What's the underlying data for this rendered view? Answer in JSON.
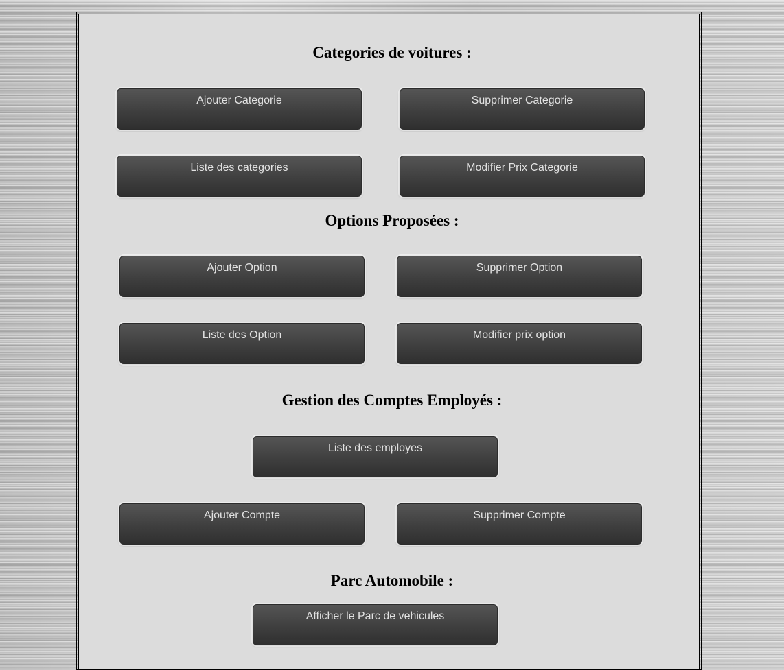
{
  "sections": {
    "categories": {
      "title": "Categories de voitures :",
      "buttons": {
        "add": "Ajouter Categorie",
        "delete": "Supprimer Categorie",
        "list": "Liste des categories",
        "edit_price": "Modifier Prix Categorie"
      }
    },
    "options": {
      "title": "Options Proposées :",
      "buttons": {
        "add": "Ajouter Option",
        "delete": "Supprimer Option",
        "list": "Liste des Option",
        "edit_price": "Modifier prix option"
      }
    },
    "employees": {
      "title": "Gestion des Comptes Employés :",
      "buttons": {
        "list": "Liste des employes",
        "add": "Ajouter Compte",
        "delete": "Supprimer Compte"
      }
    },
    "fleet": {
      "title": "Parc Automobile :",
      "buttons": {
        "show": "Afficher le Parc de vehicules"
      }
    }
  }
}
